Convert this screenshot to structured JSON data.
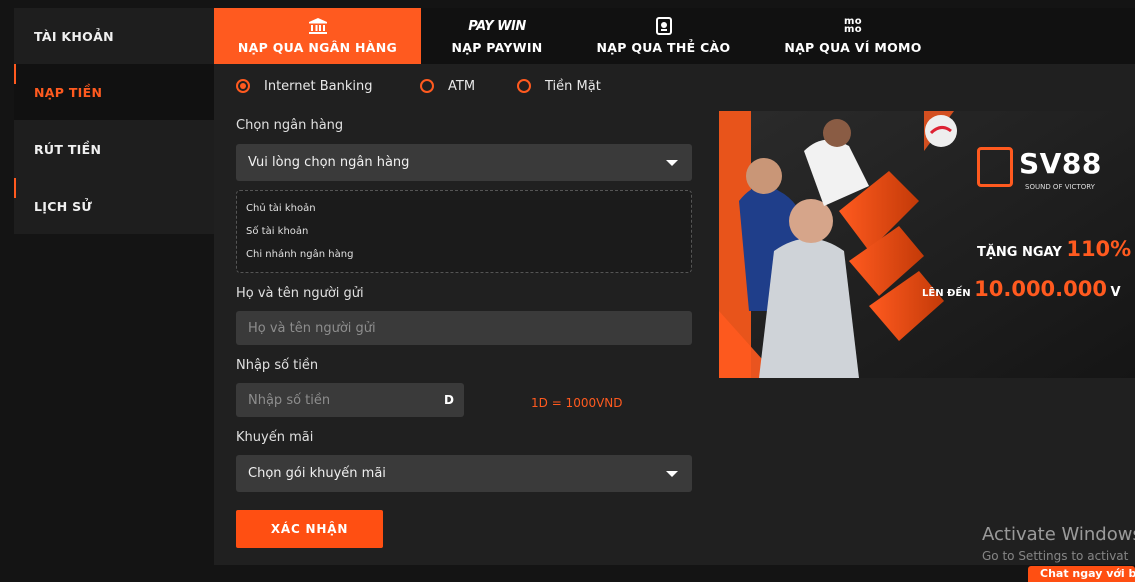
{
  "sidebar": {
    "items": [
      {
        "label": "TÀI KHOẢN"
      },
      {
        "label": "NẠP TIỀN"
      },
      {
        "label": "RÚT TIỀN"
      },
      {
        "label": "LỊCH SỬ"
      }
    ]
  },
  "tabs": [
    {
      "label": "NẠP QUA NGÂN HÀNG"
    },
    {
      "label": "NẠP PAYWIN",
      "logo": "PAY WIN"
    },
    {
      "label": "NẠP QUA THẺ CÀO"
    },
    {
      "label": "NẠP QUA VÍ MOMO",
      "logo_top": "mo",
      "logo_bottom": "mo"
    }
  ],
  "radios": [
    {
      "label": "Internet Banking",
      "checked": true
    },
    {
      "label": "ATM",
      "checked": false
    },
    {
      "label": "Tiền Mặt",
      "checked": false
    }
  ],
  "form": {
    "bank_label": "Chọn ngân hàng",
    "bank_select": "Vui lòng chọn ngân hàng",
    "info": {
      "owner": "Chủ tài khoản",
      "account_number": "Số tài khoản",
      "branch": "Chi nhánh ngân hàng"
    },
    "sender_label": "Họ và tên người gửi",
    "sender_placeholder": "Họ và tên người gửi",
    "amount_label": "Nhập số tiền",
    "amount_placeholder": "Nhập số tiền",
    "amount_suffix": "D",
    "rate": "1D = 1000VND",
    "promo_label": "Khuyến mãi",
    "promo_select": "Chọn gói khuyến mãi",
    "submit": "XÁC NHẬN"
  },
  "banner": {
    "brand": "SV88",
    "brand_tagline": "SOUND OF VICTORY",
    "line1_prefix": "TẶNG NGAY",
    "line1_value": "110%",
    "line2_prefix": "LÊN ĐẾN",
    "line2_value": "10.000.000",
    "line2_suffix": "V"
  },
  "watermark": {
    "title": "Activate Windows",
    "subtitle": "Go to Settings to activat"
  },
  "chat": {
    "label": "Chat ngay với b"
  },
  "colors": {
    "accent": "#ff5a1f",
    "background": "#141414",
    "panel": "#202020",
    "field": "#3a3a3a"
  }
}
